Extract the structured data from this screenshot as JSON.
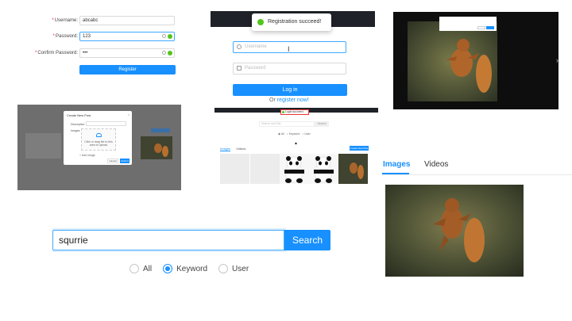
{
  "registration": {
    "username_label": "Username:",
    "username_value": "abcabc",
    "password_label": "Password:",
    "password_value": "123",
    "confirm_label": "Confirm Password:",
    "confirm_value": "•••",
    "required_mark": "*",
    "register_button": "Register"
  },
  "login": {
    "toast": "Registration succeed!",
    "username_placeholder": "Username",
    "password_placeholder": "Password",
    "login_button": "Log in",
    "or_text": "Or",
    "register_link": "register now!"
  },
  "modal": {
    "title": "Create New Post",
    "description_label": "Description",
    "images_label": "Images",
    "drop_text": "Click or drag file to this area to upload",
    "add_text": "Add Image",
    "cancel": "Cancel",
    "submit": "Submit"
  },
  "results": {
    "login_toast": "Login succeed",
    "search_placeholder": "Search and Tab",
    "search_button": "Search",
    "radio_all": "All",
    "radio_keyword": "Keyword",
    "radio_user": "User",
    "tab_images": "Images",
    "tab_videos": "Videos",
    "create_button": "Create New Post"
  },
  "search": {
    "query": "squrrie",
    "button": "Search",
    "options": [
      "All",
      "Keyword",
      "User"
    ],
    "selected": "Keyword"
  },
  "gallery": {
    "tab_images": "Images",
    "tab_videos": "Videos",
    "active_tab": "Images"
  },
  "colors": {
    "primary": "#1890ff",
    "success": "#52c41a",
    "dark_bar": "#1f2329"
  }
}
